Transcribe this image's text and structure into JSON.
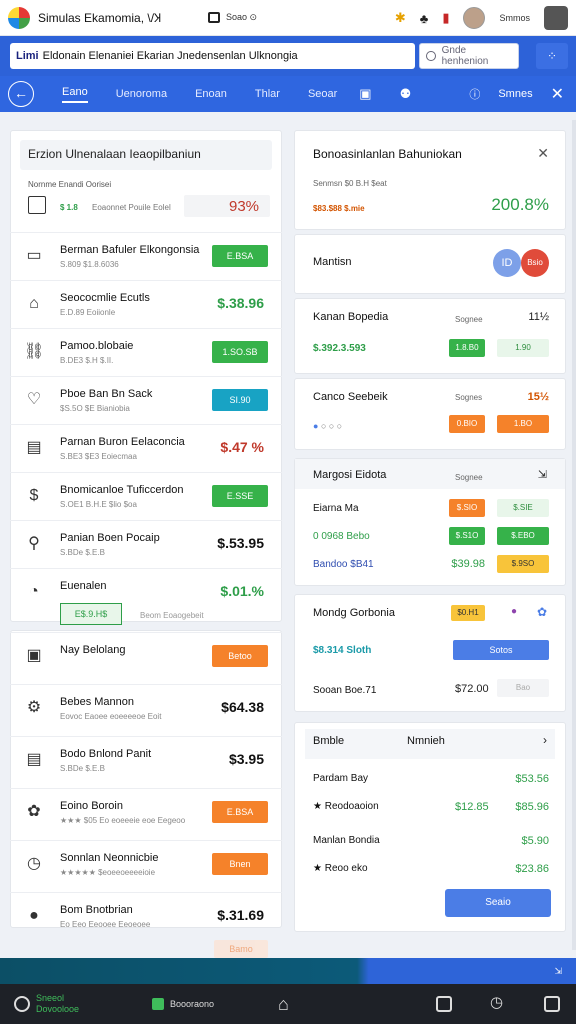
{
  "window": {
    "title": "Simulas Ekamomia, \\/Ʞ",
    "tab2": "Soao ⊙",
    "user": "Smmos"
  },
  "address": {
    "bold": "Limi",
    "text": "Eldonain Elenaniei Ekarian Jnedensenlan Ulknongia",
    "search_placeholder": "Gnde henhenion"
  },
  "nav": {
    "tabs": [
      "Eano",
      "Uenoroma",
      "Enoan",
      "Thlar",
      "Seoar"
    ],
    "active": 0,
    "right_label": "Smnes"
  },
  "left": {
    "header": "Erzion Ulnenalaan Ieaopilbaniun",
    "summary": {
      "line1": "Nornme Enandi Oorisei",
      "line2a": "$ 1.8",
      "line2b": "Eoaonnet Pouile Eolel",
      "value": "93%"
    },
    "rows": [
      {
        "icon": "briefcase-icon",
        "glyph": "▭",
        "title": "Berman Bafuler Elkongonsia",
        "sub": "S.809 $1.8.6036",
        "pill": "E.BSA",
        "pill_color": "green"
      },
      {
        "icon": "home-icon",
        "glyph": "⌂",
        "title": "Seococmlie Ecutls",
        "sub": "E.D.89 Eoiionle",
        "value": "$.38.96",
        "value_color": "#2e9e49"
      },
      {
        "icon": "link-icon",
        "glyph": "⛓",
        "title": "Pamoo.blobaie",
        "sub": "B.DE3 $.H $.II.",
        "pill": "1.SO.SB",
        "pill_color": "green"
      },
      {
        "icon": "heart-icon",
        "glyph": "♡",
        "title": "Pboe Ban Bn Sack",
        "sub": "$S.5O $E Bianiobia",
        "pill": "SI.90",
        "pill_color": "teal"
      },
      {
        "icon": "calendar-icon",
        "glyph": "▤",
        "title": "Parnan Buron Eelaconcia",
        "sub": "S.BE3 $E3 Eoiecmaa",
        "value": "$.47 %",
        "value_color": "#c0392b"
      },
      {
        "icon": "money-icon",
        "glyph": "$",
        "title": "Bnomicanloe Tuficcerdon",
        "sub": "S.OE1 B.H.E $lio $oa",
        "pill": "E.SSE",
        "pill_color": "green"
      },
      {
        "icon": "rocket-icon",
        "glyph": "⚲",
        "title": "Panian Boen Pocaip",
        "sub": "S.BDe $.E.B",
        "value": "$.53.95",
        "value_color": "#111"
      },
      {
        "icon": "gauge-icon",
        "glyph": "◔",
        "title": "Euenalen",
        "sub": "",
        "badge": "E$.9.H$",
        "value": "$.01.%",
        "value_color": "#2e9e49",
        "note": "Beom Eoaogebeit"
      }
    ],
    "rows2": [
      {
        "icon": "card-icon",
        "glyph": "▣",
        "title": "Nay Belolang",
        "sub": "",
        "pill": "Betoo",
        "pill_color": "orange"
      },
      {
        "icon": "gear-icon",
        "glyph": "⚙",
        "title": "Bebes Mannon",
        "sub": "Eovoc Eaoee eoeeeeoe Eoit",
        "value": "$64.38"
      },
      {
        "icon": "document-icon",
        "glyph": "▤",
        "title": "Bodo Bnlond Panit",
        "sub": "S.BDe $.E.B",
        "value": "$3.95"
      },
      {
        "icon": "colors-icon",
        "glyph": "✿",
        "title": "Eoino Boroin",
        "sub": "★★★ $05 Eo eoeeeie eoe Eegeoo",
        "pill": "E.BSA",
        "pill_color": "orange"
      },
      {
        "icon": "clock-icon",
        "glyph": "◷",
        "title": "Sonnlan Neonnicbie",
        "sub": "★★★★★ $eoeeoeeeeioie",
        "pill": "Bnen",
        "pill_color": "orange"
      },
      {
        "icon": "record-icon",
        "glyph": "●",
        "title": "Bom Bnotbrian",
        "sub": "Eo Eeo Eeooee Eeoeoee",
        "value": "$.31.69"
      }
    ],
    "ghost_button": "Bamo"
  },
  "right": {
    "header": "Bonoasinlanlan Bahuniokan",
    "summary": {
      "line1": "Senmsn $0 B.H $eat",
      "line2": "$83.$88 $.mie",
      "value": "200.8%"
    },
    "monthly": {
      "label": "Mantisn",
      "badge": "Bsio",
      "avatar": "ID"
    },
    "karan": {
      "title": "Kanan Bopedia",
      "sub": "Sognee",
      "count": "11½",
      "amount": "$.392.3.593",
      "pill1": "1.8.B0",
      "pill2": "1.90"
    },
    "cargo": {
      "title": "Canco Seebeik",
      "sub": "Sognes",
      "count": "15½",
      "pill1": "0.BIO",
      "pill2": "1.BO"
    },
    "margin": {
      "title": "Margosi Eidota",
      "sub": "Sognee",
      "rows": [
        {
          "label": "Eiarna Ma",
          "p1": "$.SIO",
          "p2": "$.SIE",
          "c1": "orange",
          "c2": "lg"
        },
        {
          "label": "0 0968 Bebo",
          "p1": "$.S1O",
          "p2": "$.EBO",
          "c1": "green",
          "c2": "green"
        },
        {
          "label": "Bandoo $B41",
          "v": "$39.98",
          "p2": "$.9SO",
          "c2": "yellow"
        }
      ]
    },
    "mondg": {
      "title": "Mondg Gorbonia",
      "sub": "$0.H1",
      "line": "$8.314 Sloth",
      "pill": "Sotos",
      "price": "$72.00",
      "bottom_label": "Sooan Boe.71",
      "bottom_tag": "Bao"
    },
    "bottom": {
      "label1": "Bmble",
      "label2": "Nmnieh",
      "rows": [
        {
          "t": "Pardam Bay",
          "a": "$53.56"
        },
        {
          "t": "★ Reodoaoion",
          "b": "$12.85",
          "a": "$85.96"
        },
        {
          "t": "Manlan Bondia",
          "a": "$5.90"
        },
        {
          "t": "★ Reoo eko",
          "a": "$23.86"
        }
      ],
      "button": "Seaio"
    }
  },
  "taskbar": {
    "app1": "Sneeol Dovoolooe",
    "app2": "Boooraono"
  }
}
